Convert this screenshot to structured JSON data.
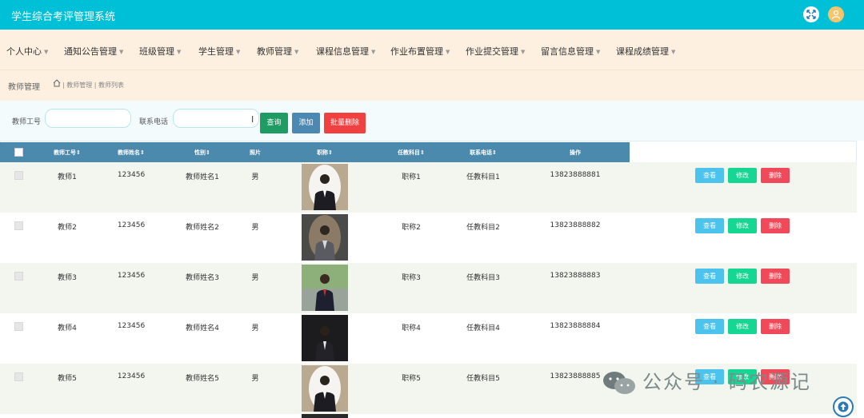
{
  "app": {
    "title": "学生综合考评管理系统"
  },
  "colors": {
    "topbar": "#00c0d8",
    "navbar": "#fdf0e0",
    "table_header": "#4b89ad",
    "view": "#4cc3ec",
    "edit": "#16d694",
    "delete": "#f04a5a"
  },
  "nav": {
    "items": [
      {
        "label": "个人中心"
      },
      {
        "label": "通知公告管理"
      },
      {
        "label": "班级管理"
      },
      {
        "label": "学生管理"
      },
      {
        "label": "教师管理"
      },
      {
        "label": "课程信息管理"
      },
      {
        "label": "作业布置管理"
      },
      {
        "label": "作业提交管理"
      },
      {
        "label": "留言信息管理"
      },
      {
        "label": "课程成绩管理"
      }
    ]
  },
  "breadcrumb": {
    "title": "教师管理",
    "path": "| 教师管理 | 教师列表"
  },
  "search": {
    "label_id": "教师工号",
    "label_phone": "联系电话",
    "value_id": "",
    "value_phone": "",
    "search_btn": "查询",
    "add_btn": "添加",
    "batch_delete_btn": "批量删除"
  },
  "table": {
    "headers": [
      "教师工号⇕",
      "教师姓名⇕",
      "性别⇕",
      "照片",
      "职称⇕",
      "任教科目⇕",
      "联系电话⇕",
      "操作"
    ],
    "rows": [
      {
        "id": "教师1",
        "pwd": "123456",
        "name": "教师姓名1",
        "gender": "男",
        "title": "职称1",
        "subject": "任教科目1",
        "phone": "13823888881"
      },
      {
        "id": "教师2",
        "pwd": "123456",
        "name": "教师姓名2",
        "gender": "男",
        "title": "职称2",
        "subject": "任教科目2",
        "phone": "13823888882"
      },
      {
        "id": "教师3",
        "pwd": "123456",
        "name": "教师姓名3",
        "gender": "男",
        "title": "职称3",
        "subject": "任教科目3",
        "phone": "13823888883"
      },
      {
        "id": "教师4",
        "pwd": "123456",
        "name": "教师姓名4",
        "gender": "男",
        "title": "职称4",
        "subject": "任教科目4",
        "phone": "13823888884"
      },
      {
        "id": "教师5",
        "pwd": "123456",
        "name": "教师姓名5",
        "gender": "男",
        "title": "职称5",
        "subject": "任教科目5",
        "phone": "13823888885"
      }
    ],
    "actions": {
      "view": "查看",
      "edit": "修改",
      "delete": "删除"
    }
  },
  "watermark": {
    "text": "公众号 · 码农源记"
  }
}
